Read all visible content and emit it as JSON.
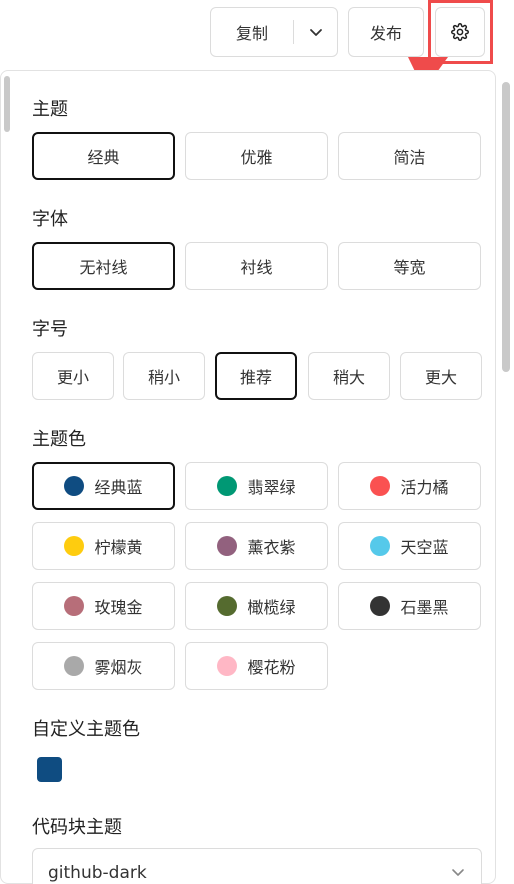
{
  "toolbar": {
    "copy_label": "复制",
    "publish_label": "发布"
  },
  "sections": {
    "theme": "主题",
    "font": "字体",
    "font_size": "字号",
    "theme_color": "主题色",
    "custom_color": "自定义主题色",
    "code_theme": "代码块主题"
  },
  "theme_options": [
    {
      "label": "经典",
      "selected": true
    },
    {
      "label": "优雅",
      "selected": false
    },
    {
      "label": "简洁",
      "selected": false
    }
  ],
  "font_options": [
    {
      "label": "无衬线",
      "selected": true
    },
    {
      "label": "衬线",
      "selected": false
    },
    {
      "label": "等宽",
      "selected": false
    }
  ],
  "size_options": [
    {
      "label": "更小",
      "selected": false
    },
    {
      "label": "稍小",
      "selected": false
    },
    {
      "label": "推荐",
      "selected": true
    },
    {
      "label": "稍大",
      "selected": false
    },
    {
      "label": "更大",
      "selected": false
    }
  ],
  "color_options": [
    {
      "label": "经典蓝",
      "color": "#0f4c81",
      "selected": true
    },
    {
      "label": "翡翠绿",
      "color": "#009874",
      "selected": false
    },
    {
      "label": "活力橘",
      "color": "#fa5151",
      "selected": false
    },
    {
      "label": "柠檬黄",
      "color": "#fecc0f",
      "selected": false
    },
    {
      "label": "薰衣紫",
      "color": "#92617e",
      "selected": false
    },
    {
      "label": "天空蓝",
      "color": "#55c9ea",
      "selected": false
    },
    {
      "label": "玫瑰金",
      "color": "#b76e79",
      "selected": false
    },
    {
      "label": "橄榄绿",
      "color": "#556b2f",
      "selected": false
    },
    {
      "label": "石墨黑",
      "color": "#333333",
      "selected": false
    },
    {
      "label": "雾烟灰",
      "color": "#a9a9a9",
      "selected": false
    },
    {
      "label": "樱花粉",
      "color": "#ffb7c5",
      "selected": false
    }
  ],
  "custom_color_value": "#0f4c81",
  "code_theme_value": "github-dark",
  "accent_annotation": "#ef4b4b"
}
